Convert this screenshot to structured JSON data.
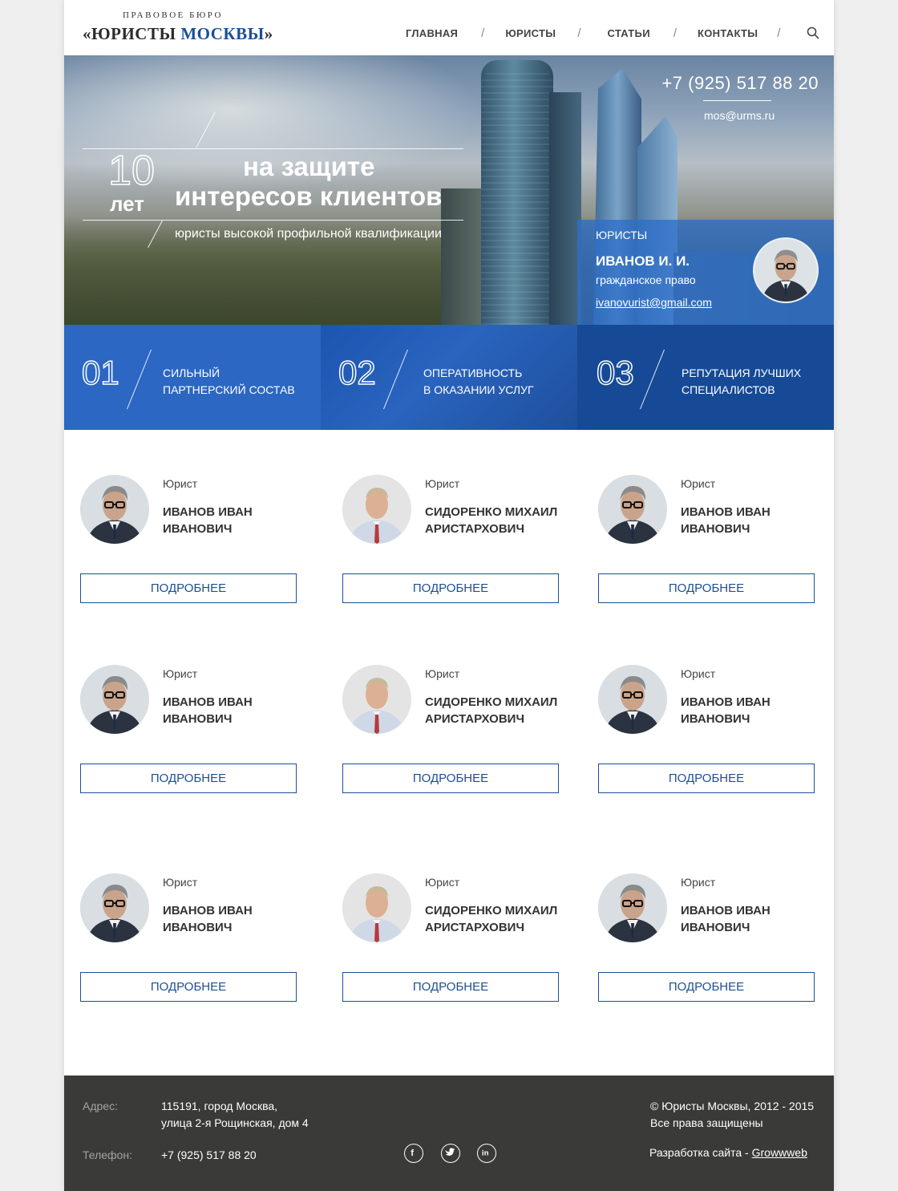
{
  "header": {
    "logo_top": "ПРАВОВОЕ БЮРО",
    "logo_main_1": "«ЮРИСТЫ ",
    "logo_main_2": "МОСКВЫ",
    "logo_main_3": "»",
    "nav": [
      {
        "label": "ГЛАВНАЯ"
      },
      {
        "label": "ЮРИСТЫ"
      },
      {
        "label": "СТАТЬИ"
      },
      {
        "label": "КОНТАКТЫ"
      }
    ],
    "separator": "/",
    "search_icon": "search-icon"
  },
  "hero": {
    "phone": "+7 (925) 517 88 20",
    "email": "mos@urms.ru",
    "years_number": "10",
    "years_word": "лет",
    "title_line1": "на защите",
    "title_line2": "интересов клиентов",
    "subtitle": "юристы высокой профильной квалификации",
    "card": {
      "label": "ЮРИСТЫ",
      "name": "ИВАНОВ И. И.",
      "specialty": "гражданское право",
      "email": "ivanovurist@gmail.com"
    }
  },
  "features": [
    {
      "num": "01",
      "line1": "СИЛЬНЫЙ",
      "line2": "ПАРТНЕРСКИЙ СОСТАВ"
    },
    {
      "num": "02",
      "line1": "ОПЕРАТИВНОСТЬ",
      "line2": "В ОКАЗАНИИ УСЛУГ"
    },
    {
      "num": "03",
      "line1": "РЕПУТАЦИЯ ЛУЧШИХ",
      "line2": "СПЕЦИАЛИСТОВ"
    }
  ],
  "lawyers": [
    {
      "role": "Юрист",
      "name1": "ИВАНОВ ИВАН",
      "name2": "ИВАНОВИЧ",
      "button": "ПОДРОБНЕЕ",
      "photo": "glasses"
    },
    {
      "role": "Юрист",
      "name1": "СИДОРЕНКО МИХАИЛ",
      "name2": "АРИСТАРХОВИЧ",
      "button": "ПОДРОБНЕЕ",
      "photo": "older"
    },
    {
      "role": "Юрист",
      "name1": "ИВАНОВ ИВАН",
      "name2": "ИВАНОВИЧ",
      "button": "ПОДРОБНЕЕ",
      "photo": "glasses"
    },
    {
      "role": "Юрист",
      "name1": "ИВАНОВ ИВАН",
      "name2": "ИВАНОВИЧ",
      "button": "ПОДРОБНЕЕ",
      "photo": "glasses"
    },
    {
      "role": "Юрист",
      "name1": "СИДОРЕНКО МИХАИЛ",
      "name2": "АРИСТАРХОВИЧ",
      "button": "ПОДРОБНЕЕ",
      "photo": "older"
    },
    {
      "role": "Юрист",
      "name1": "ИВАНОВ ИВАН",
      "name2": "ИВАНОВИЧ",
      "button": "ПОДРОБНЕЕ",
      "photo": "glasses"
    },
    {
      "role": "Юрист",
      "name1": "ИВАНОВ ИВАН",
      "name2": "ИВАНОВИЧ",
      "button": "ПОДРОБНЕЕ",
      "photo": "glasses"
    },
    {
      "role": "Юрист",
      "name1": "СИДОРЕНКО МИХАИЛ",
      "name2": "АРИСТАРХОВИЧ",
      "button": "ПОДРОБНЕЕ",
      "photo": "older"
    },
    {
      "role": "Юрист",
      "name1": "ИВАНОВ ИВАН",
      "name2": "ИВАНОВИЧ",
      "button": "ПОДРОБНЕЕ",
      "photo": "glasses"
    }
  ],
  "footer": {
    "address_label": "Адрес:",
    "address_line1": "115191, город Москва,",
    "address_line2": "улица 2-я Рощинская, дом 4",
    "phone_label": "Телефон:",
    "phone": "+7 (925) 517 88 20",
    "social": [
      "facebook-icon",
      "twitter-icon",
      "linkedin-icon"
    ],
    "copyright": "© Юристы Москвы, 2012 - 2015",
    "rights": "Все права защищены",
    "dev_prefix": "Разработка сайта - ",
    "dev_link": "Growwweb"
  },
  "colors": {
    "accent": "#1c4f95",
    "feature1": "#2b67c3",
    "feature3": "#164a96",
    "footer": "#3a3a39",
    "page_bg": "#efefef"
  }
}
